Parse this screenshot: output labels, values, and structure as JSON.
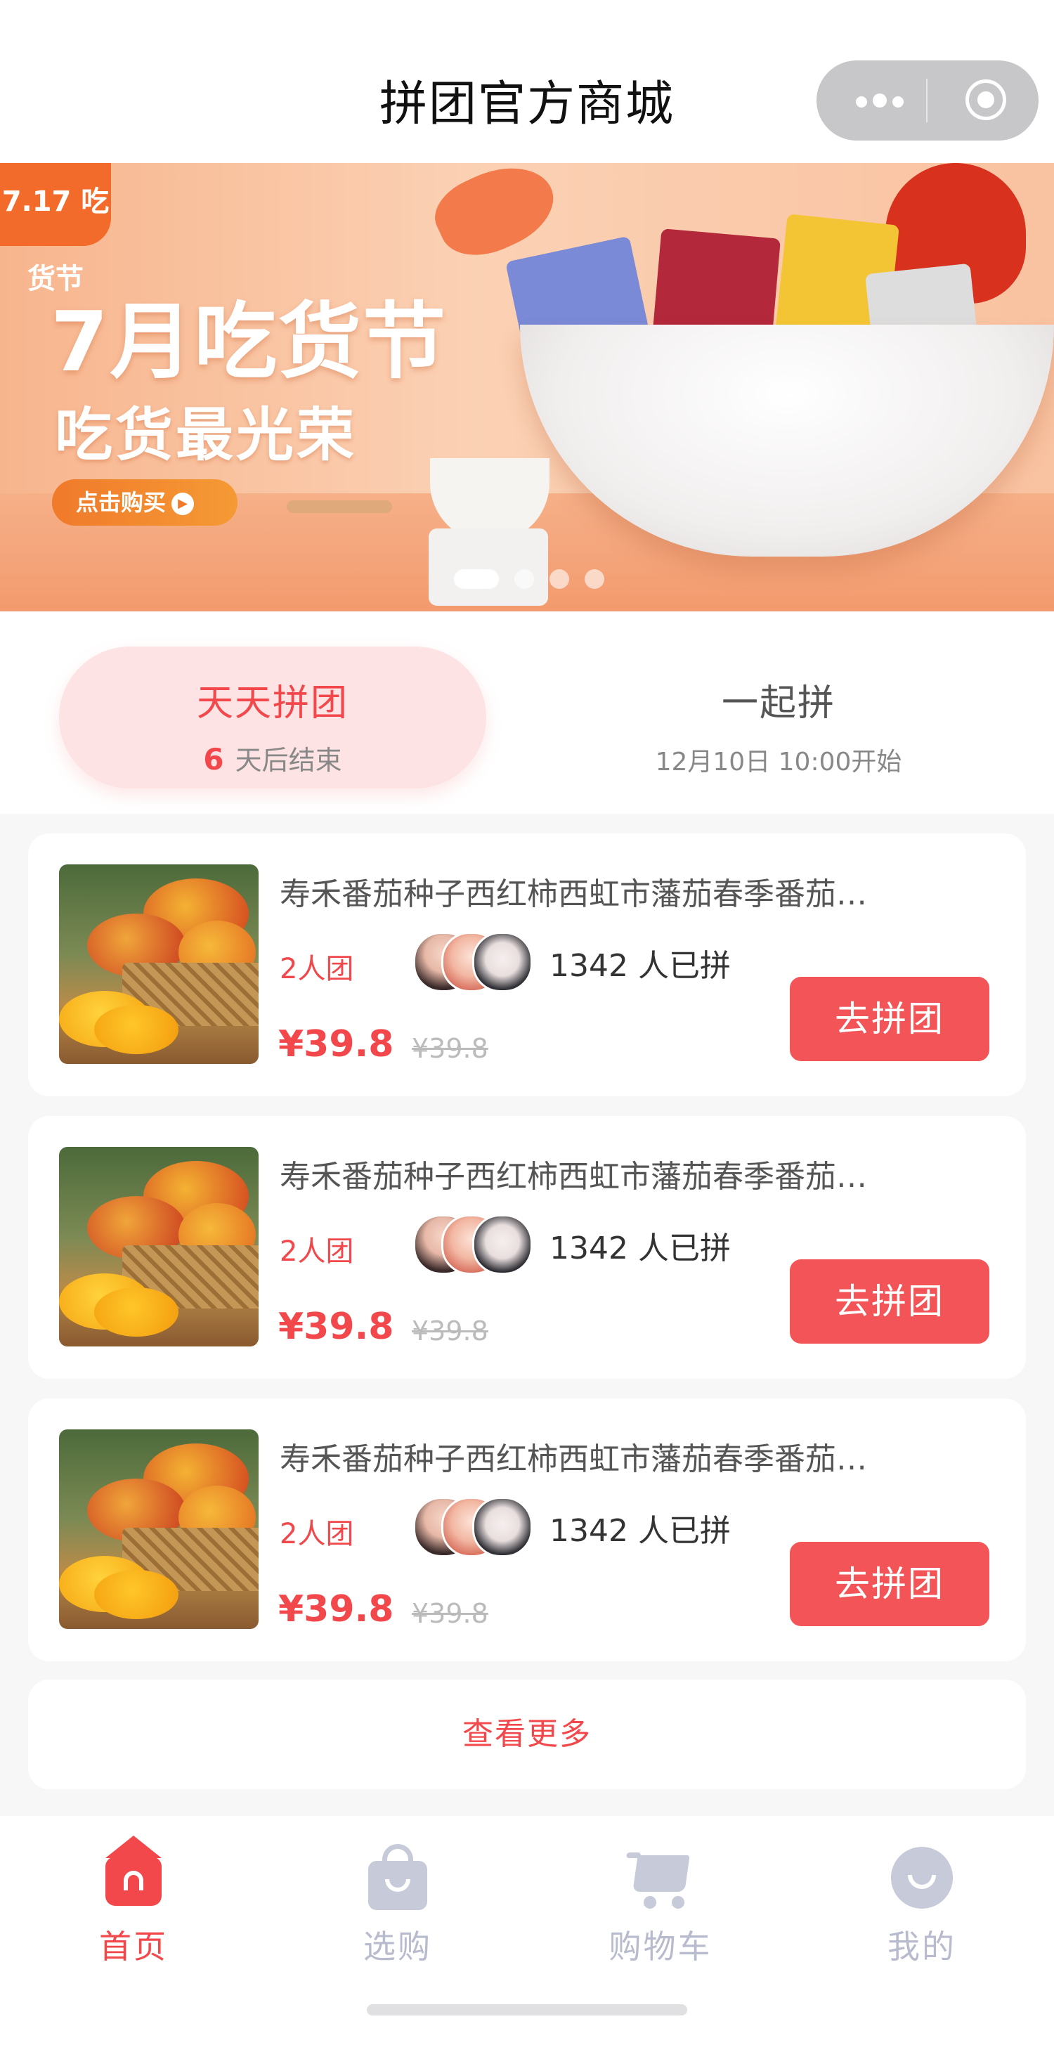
{
  "header": {
    "title": "拼团官方商城"
  },
  "banner": {
    "badge_text": "7.17 吃货节",
    "headline": "7月吃货节",
    "subheadline": "吃货最光荣",
    "cta_label": "点击购买",
    "pages": 4,
    "active_page": 1
  },
  "tabs": {
    "active": {
      "label": "天天拼团",
      "days": "6",
      "suffix": "天后结束"
    },
    "second": {
      "label": "一起拼",
      "start_text": "12月10日 10:00开始"
    }
  },
  "products": [
    {
      "name": "寿禾番茄种子西红柿西虹市藩茄春季番茄种子",
      "group_tag": "2人团",
      "joined": "1342 人已拼",
      "price": "¥39.8",
      "orig_price": "¥39.8",
      "button": "去拼团"
    },
    {
      "name": "寿禾番茄种子西红柿西虹市藩茄春季番茄种子",
      "group_tag": "2人团",
      "joined": "1342 人已拼",
      "price": "¥39.8",
      "orig_price": "¥39.8",
      "button": "去拼团"
    },
    {
      "name": "寿禾番茄种子西红柿西虹市藩茄春季番茄种子",
      "group_tag": "2人团",
      "joined": "1342 人已拼",
      "price": "¥39.8",
      "orig_price": "¥39.8",
      "button": "去拼团"
    }
  ],
  "more_label": "查看更多",
  "tabbar": {
    "items": [
      {
        "label": "首页",
        "icon": "home-icon",
        "active": true
      },
      {
        "label": "选购",
        "icon": "shopping-bag-icon",
        "active": false
      },
      {
        "label": "购物车",
        "icon": "cart-icon",
        "active": false
      },
      {
        "label": "我的",
        "icon": "profile-icon",
        "active": false
      }
    ]
  },
  "colors": {
    "accent": "#f2484b",
    "button": "#f35457",
    "tab_active_bg": "#fde3e3",
    "inactive_icon": "#c7cad9"
  }
}
